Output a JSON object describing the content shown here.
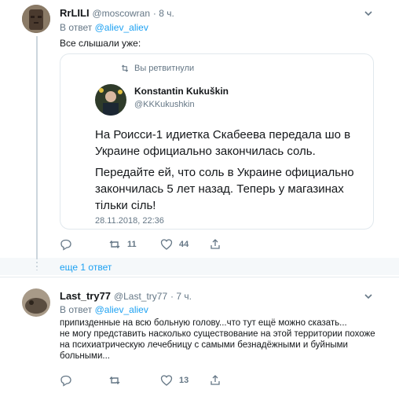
{
  "tweet1": {
    "name": "RrLILI",
    "handle": "@moscowran",
    "time": "· 8 ч.",
    "reply_prefix": "В ответ",
    "reply_to": "@aliev_aliev",
    "text": "Все слышали уже:",
    "retweet_label": "Вы ретвитнули",
    "quote": {
      "name": "Konstantin Kukuškin",
      "handle": "@KKKukushkin",
      "para1": "На Роисси-1 идиетка Скабеева передала шо в Украине официально закончилась соль.",
      "para2": "Передайте ей, что соль в Украине официально закончилась 5 лет назад. Теперь у магазинах тільки сіль!",
      "date": "28.11.2018, 22:36"
    },
    "actions": {
      "replies": "",
      "retweets": "11",
      "likes": "44"
    }
  },
  "more_replies": "еще 1 ответ",
  "tweet2": {
    "name": "Last_try77",
    "handle": "@Last_try77",
    "time": "· 7 ч.",
    "reply_prefix": "В ответ",
    "reply_to": "@aliev_aliev",
    "line1": "припизденные на всю больную голову...что тут ещё можно сказать...",
    "line2": "не могу представить насколько существование на этой территории похоже",
    "line3": "на психиатрическую лечебницу с самыми безнадёжными и буйными",
    "line4": "больными...",
    "actions": {
      "replies": "",
      "retweets": "",
      "likes": "13"
    }
  },
  "colors": {
    "accent": "#1da1f2",
    "muted": "#657786",
    "border": "#e1e8ed"
  }
}
